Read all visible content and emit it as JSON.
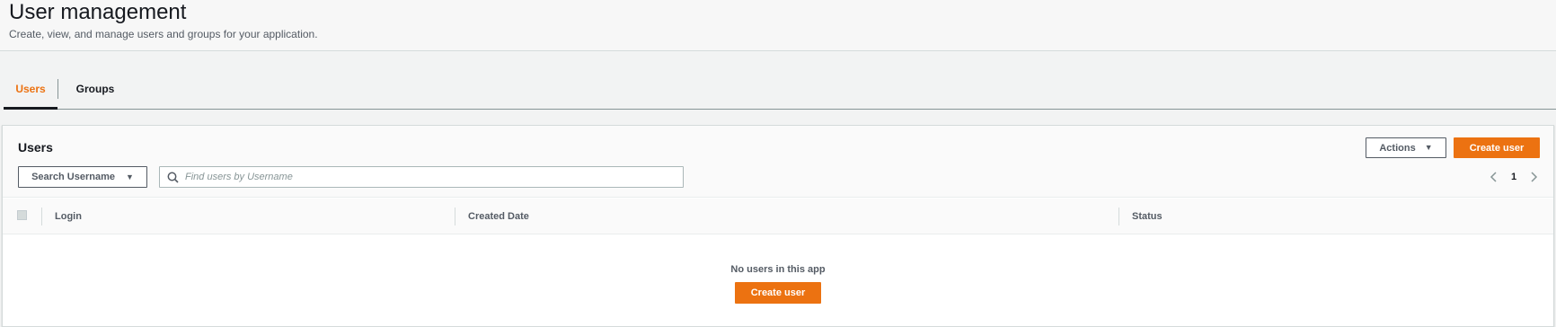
{
  "header": {
    "title": "User management",
    "subtitle": "Create, view, and manage users and groups for your application."
  },
  "tabs": [
    {
      "label": "Users",
      "active": true
    },
    {
      "label": "Groups",
      "active": false
    }
  ],
  "panel": {
    "title": "Users",
    "actions_label": "Actions",
    "create_label": "Create user",
    "search_attribute": "Search Username",
    "search_placeholder": "Find users by Username",
    "page_number": "1"
  },
  "table": {
    "columns": [
      "Login",
      "Created Date",
      "Status"
    ],
    "rows": []
  },
  "empty_state": {
    "message": "No users in this app",
    "button_label": "Create user"
  },
  "colors": {
    "accent": "#ec7211",
    "text": "#16191f",
    "muted": "#545b64",
    "background": "#f2f3f3"
  },
  "icons": [
    "caret-down-icon",
    "search-icon",
    "chevron-left-icon",
    "chevron-right-icon"
  ]
}
